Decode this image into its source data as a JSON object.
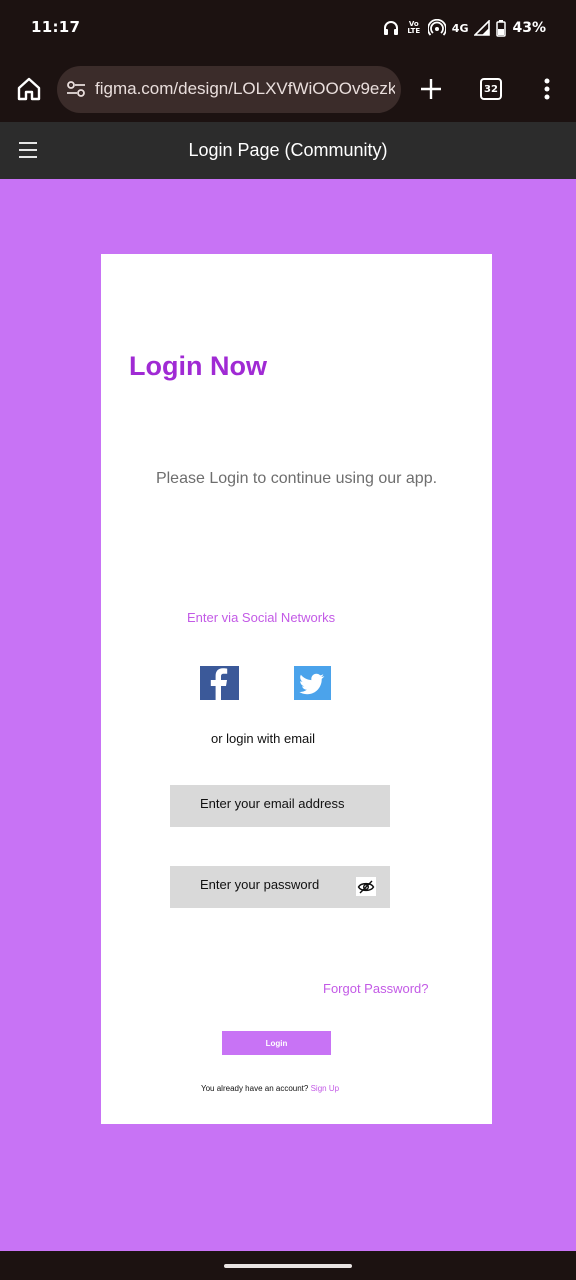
{
  "status_bar": {
    "time": "11:17",
    "volte_label": "Vo LTE",
    "network": "4G",
    "battery": "43%"
  },
  "browser": {
    "url": "figma.com/design/LOLXVfWiOOOv9ezkFz",
    "tab_count": "32"
  },
  "figma": {
    "title": "Login Page (Community)"
  },
  "login": {
    "heading": "Login Now",
    "subtitle": "Please Login to continue using our app.",
    "social_label": "Enter via Social Networks",
    "or_label": "or login with email",
    "email_placeholder": "Enter your email address",
    "password_placeholder": "Enter your password",
    "forgot_password": "Forgot Password?",
    "login_button": "Login",
    "account_prompt": "You already have an account?",
    "signup_link": "Sign Up"
  },
  "colors": {
    "canvas_background": "#c873f5",
    "heading": "#a02ad4",
    "link": "#c35ae6",
    "facebook": "#3b5999",
    "twitter": "#4ba3eb",
    "input_background": "#d9d9d9"
  },
  "icons": {
    "facebook": "facebook-icon",
    "twitter": "twitter-icon",
    "password_toggle": "eye-off-icon",
    "home": "home-icon",
    "site_settings": "tune-icon",
    "new_tab": "plus-icon",
    "menu": "more-vertical-icon"
  }
}
